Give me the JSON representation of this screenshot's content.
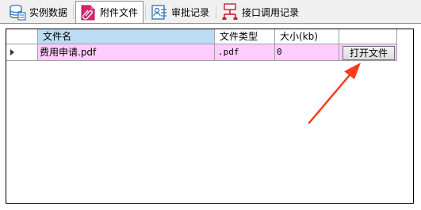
{
  "tabs": [
    {
      "label": "实例数据",
      "icon": "database-icon",
      "active": false
    },
    {
      "label": "附件文件",
      "icon": "paperclip-icon",
      "active": true
    },
    {
      "label": "审批记录",
      "icon": "approval-record-icon",
      "active": false
    },
    {
      "label": "接口调用记录",
      "icon": "network-icon",
      "active": false
    }
  ],
  "table": {
    "columns": [
      "文件名",
      "文件类型",
      "大小(kb)",
      ""
    ],
    "rows": [
      {
        "file_name": "费用申请.pdf",
        "file_type": ".pdf",
        "size": "0",
        "action_label": "打开文件"
      }
    ]
  },
  "colors": {
    "header_bg": "#bcdcf4",
    "row_bg": "#ffccff",
    "arrow": "#ff3a1e"
  }
}
